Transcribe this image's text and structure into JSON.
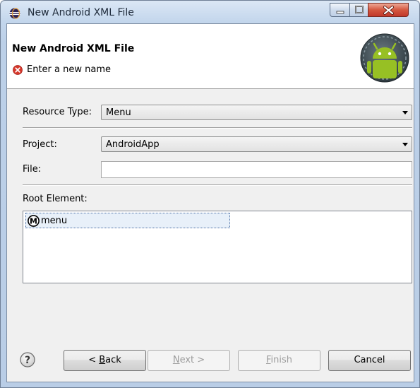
{
  "window": {
    "title": "New Android XML File",
    "controls": [
      "minimize-icon",
      "maximize-icon",
      "close-icon"
    ]
  },
  "header": {
    "title": "New Android XML File",
    "message": "Enter a new name",
    "message_icon": "error-icon",
    "logo": "android-logo"
  },
  "form": {
    "resource_type_label": "Resource Type:",
    "resource_type_value": "Menu",
    "project_label": "Project:",
    "project_value": "AndroidApp",
    "file_label": "File:",
    "file_value": "",
    "root_element_label": "Root Element:",
    "root_elements": [
      {
        "icon": "menu-element-icon",
        "icon_letter": "M",
        "label": "menu"
      }
    ]
  },
  "buttons": {
    "help_icon": "help-icon",
    "back_prefix": "< ",
    "back_mnemonic": "B",
    "back_rest": "ack",
    "next_mnemonic": "N",
    "next_rest": "ext >",
    "finish_mnemonic": "F",
    "finish_rest": "inish",
    "cancel": "Cancel"
  },
  "colors": {
    "error": "#d6372b",
    "android_green": "#97c024",
    "dialog_bg": "#f0f0f0"
  }
}
